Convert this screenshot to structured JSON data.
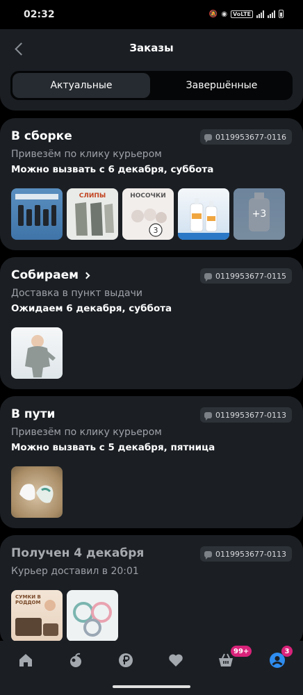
{
  "status_bar": {
    "time": "02:32",
    "network": "VoLTE"
  },
  "header": {
    "title": "Заказы"
  },
  "tabs": [
    {
      "label": "Актуальные"
    },
    {
      "label": "Завершённые"
    }
  ],
  "orders": [
    {
      "status": "В сборке",
      "order_number": "0119953677-0116",
      "delivery": "Привезём по клику курьером",
      "info": "Можно вызвать с 6 декабря, суббота",
      "thumb_labels": [
        "",
        "СЛИПЫ",
        "НОСОЧКИ",
        "",
        ""
      ],
      "more": "+3"
    },
    {
      "status": "Собираем",
      "order_number": "0119953677-0115",
      "delivery": "Доставка в пункт выдачи",
      "info": "Ожидаем 6 декабря, суббота"
    },
    {
      "status": "В пути",
      "order_number": "0119953677-0113",
      "delivery": "Привезём по клику курьером",
      "info": "Можно вызвать с 5 декабря, пятница"
    },
    {
      "status": "Получен 4 декабря",
      "order_number": "0119953677-0113",
      "delivery": "Курьер доставил в 20:01",
      "thumb_labels": [
        "СУМКИ В РОДДОМ",
        ""
      ]
    }
  ],
  "bottom_nav": {
    "items": [
      "home-icon",
      "catalog-icon",
      "ruble-icon",
      "heart-icon",
      "basket-icon",
      "profile-icon"
    ],
    "basket_badge": "99+",
    "profile_badge": "3"
  },
  "colors": {
    "accent": "#2f8df0",
    "badge": "#d9237a",
    "card": "#1b1f24"
  }
}
